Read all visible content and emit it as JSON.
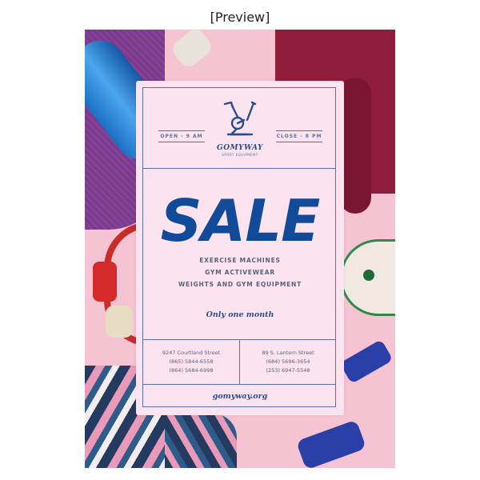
{
  "preview": {
    "label": "[Preview]"
  },
  "poster": {
    "open_hours": "OPEN - 9 AM",
    "close_hours": "CLOSE - 8 PM",
    "brand_name": "GOMYWAY",
    "brand_tagline": "SPORT EQUIPMENT",
    "headline": "SALE",
    "items": [
      "EXERCISE MACHINES",
      "GYM ACTIVEWEAR",
      "WEIGHTS AND GYM EQUIPMENT"
    ],
    "offer": "Only one month",
    "locations": [
      {
        "street": "9247 Courtland Street",
        "phone1": "(865) 5844-6558",
        "phone2": "(864) 5684-6998"
      },
      {
        "street": "89 S. Lantern Street",
        "phone1": "(684) 5696-3654",
        "phone2": "(253) 6947-5548"
      }
    ],
    "website": "gomyway.org"
  },
  "colors": {
    "accent": "#124a9a",
    "card_background": "#fbe4ef",
    "poster_background": "#f6c3d2"
  },
  "icons": {
    "logo": "exercise-bike-icon"
  }
}
